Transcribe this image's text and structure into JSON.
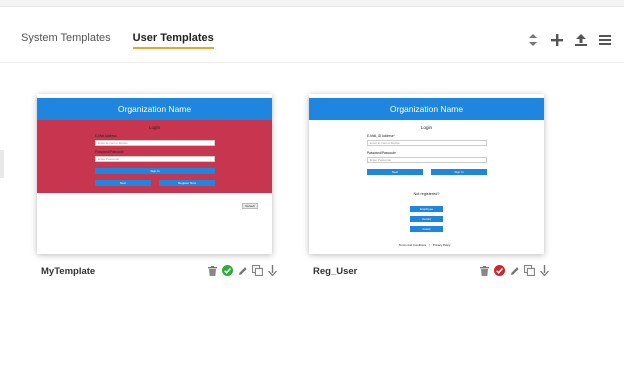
{
  "tabs": [
    {
      "label": "System Templates"
    },
    {
      "label": "User Templates"
    }
  ],
  "toolbar_icons": [
    "sort-icon",
    "add-icon",
    "upload-icon",
    "menu-icon"
  ],
  "templates": [
    {
      "name": "MyTemplate",
      "status_color": "#2eaa3e",
      "preview": {
        "org_name": "Organization Name",
        "login_title": "Login",
        "email_label": "E-Mail Address",
        "email_placeholder": "Enter E-mail or Mobile",
        "password_label": "Password/Passcode",
        "password_placeholder": "Enter Passcode",
        "signin_label": "Sign In",
        "next_label": "Next",
        "register_label": "Register Now",
        "default_label": "Default"
      }
    },
    {
      "name": "Reg_User",
      "status_color": "#c8292e",
      "preview": {
        "org_name": "Organization Name",
        "login_title": "Login",
        "email_label": "E-Mail, ID Address*",
        "email_placeholder": "Enter E-mail or Mobile",
        "password_label": "Password/Passcode",
        "password_placeholder": "Enter Passcode",
        "next_label": "Next",
        "signin_label": "Sign In",
        "not_registered": "Not registered?",
        "employee_label": "Employee",
        "vendor_label": "Vendor",
        "guest_label": "Guest",
        "footer_terms": "Terms And Conditions",
        "footer_sep": "|",
        "footer_privacy": "Privacy Policy"
      }
    }
  ]
}
